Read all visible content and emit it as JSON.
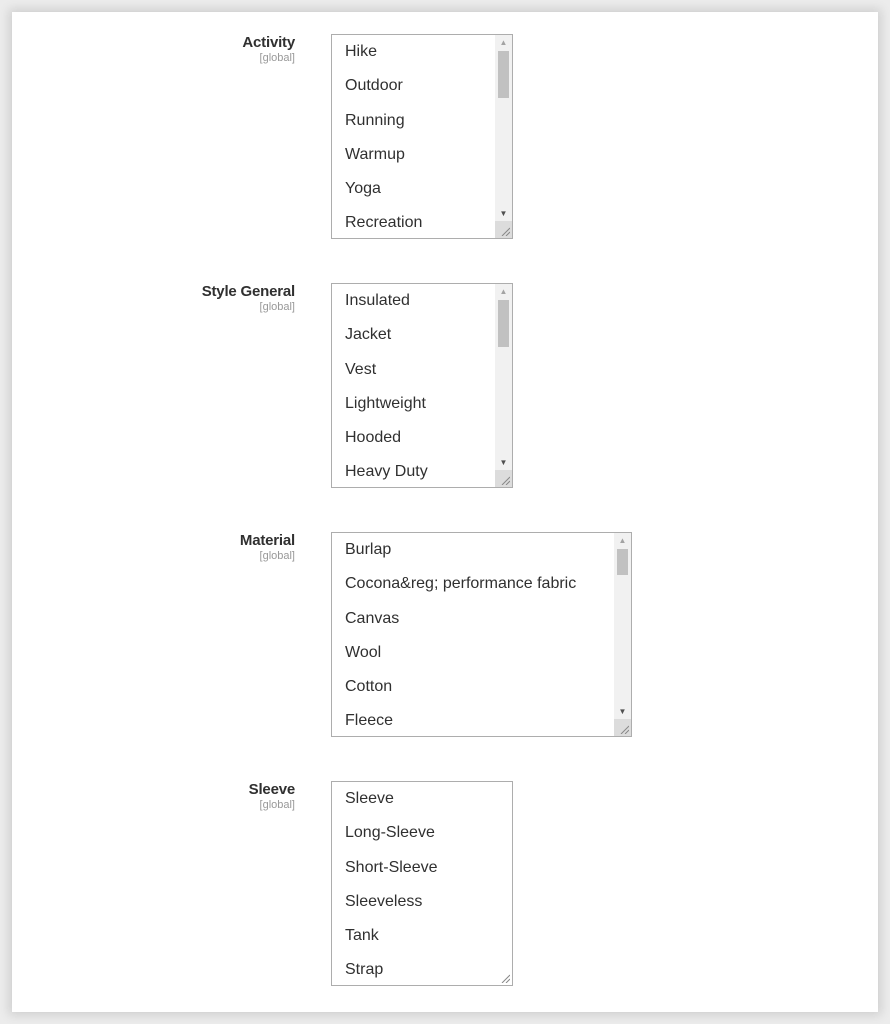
{
  "fields": [
    {
      "label": "Activity",
      "scope": "[global]",
      "options": [
        "Hike",
        "Outdoor",
        "Running",
        "Warmup",
        "Yoga",
        "Recreation"
      ],
      "scrollbar": true
    },
    {
      "label": "Style General",
      "scope": "[global]",
      "options": [
        "Insulated",
        "Jacket",
        "Vest",
        "Lightweight",
        "Hooded",
        "Heavy Duty"
      ],
      "scrollbar": true
    },
    {
      "label": "Material",
      "scope": "[global]",
      "options": [
        "Burlap",
        "Cocona&reg; performance fabric",
        "Canvas",
        "Wool",
        "Cotton",
        "Fleece"
      ],
      "scrollbar": true
    },
    {
      "label": "Sleeve",
      "scope": "[global]",
      "options": [
        "Sleeve",
        "Long-Sleeve",
        "Short-Sleeve",
        "Sleeveless",
        "Tank",
        "Strap"
      ],
      "scrollbar": false
    }
  ],
  "icons": {
    "scroll_up": "▲",
    "scroll_down": "▼"
  }
}
